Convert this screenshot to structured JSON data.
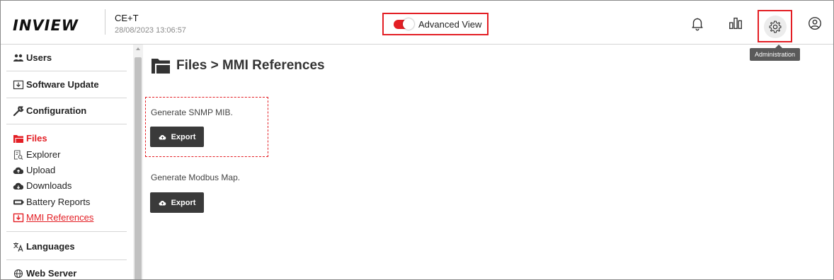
{
  "header": {
    "logo": "INVIEW",
    "device_name": "CE+T",
    "device_time": "28/08/2023 13:06:57",
    "advanced_view_label": "Advanced View",
    "advanced_view_on": true,
    "icons": [
      "bell-icon",
      "bar-chart-icon",
      "gear-icon",
      "user-icon"
    ],
    "tooltip": "Administration"
  },
  "sidebar": {
    "items": [
      {
        "label": "Users",
        "icon": "users-icon"
      },
      {
        "label": "Software Update",
        "icon": "download-box-icon"
      },
      {
        "label": "Configuration",
        "icon": "wrench-icon"
      },
      {
        "label": "Files",
        "icon": "folder-icon"
      },
      {
        "label": "Explorer",
        "icon": "file-search-icon"
      },
      {
        "label": "Upload",
        "icon": "cloud-upload-icon"
      },
      {
        "label": "Downloads",
        "icon": "cloud-download-icon"
      },
      {
        "label": "Battery Reports",
        "icon": "battery-icon"
      },
      {
        "label": "MMI References",
        "icon": "download-box-icon"
      },
      {
        "label": "Languages",
        "icon": "translate-icon"
      },
      {
        "label": "Web Server",
        "icon": "globe-icon"
      }
    ]
  },
  "main": {
    "title": "Files > MMI References",
    "sections": [
      {
        "label": "Generate SNMP MIB.",
        "button": "Export"
      },
      {
        "label": "Generate Modbus Map.",
        "button": "Export"
      }
    ]
  },
  "colors": {
    "accent": "#e31e24",
    "button": "#3a3a3a"
  }
}
